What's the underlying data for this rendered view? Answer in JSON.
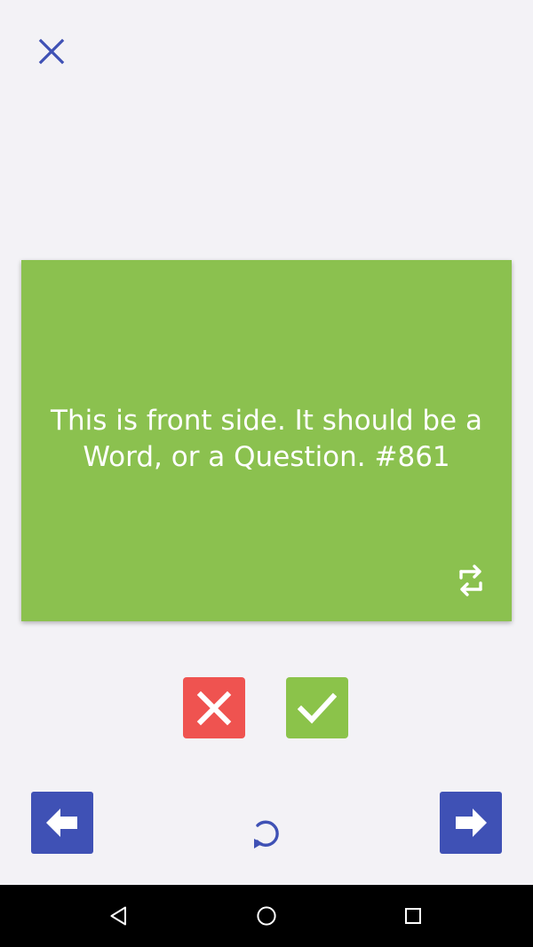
{
  "colors": {
    "background": "#f3f2f6",
    "card": "#8bc14f",
    "wrong": "#ef5350",
    "correct": "#8bc34a",
    "primary": "#3f51b5"
  },
  "icons": {
    "close": "close-icon",
    "flip": "swap-horizontal-icon",
    "wrong": "cross-icon",
    "correct": "check-icon",
    "previous": "arrow-left-icon",
    "next": "arrow-right-icon",
    "reset": "rotate-left-icon",
    "system_back": "triangle-back-icon",
    "system_home": "circle-home-icon",
    "system_recent": "square-recents-icon"
  },
  "card": {
    "text": "This is front side. It should be a Word, or a Question. #861"
  }
}
